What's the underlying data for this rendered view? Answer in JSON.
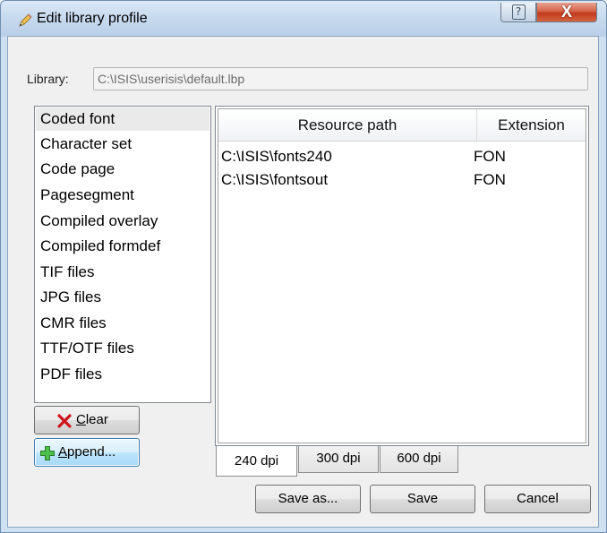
{
  "window": {
    "title": "Edit library profile",
    "close_symbol": "X",
    "help_symbol": "?"
  },
  "library": {
    "label": "Library:",
    "value": "C:\\ISIS\\userisis\\default.lbp"
  },
  "categories": [
    {
      "label": "Coded font",
      "selected": true
    },
    {
      "label": "Character set"
    },
    {
      "label": "Code page"
    },
    {
      "label": "Pagesegment"
    },
    {
      "label": "Compiled overlay"
    },
    {
      "label": "Compiled formdef"
    },
    {
      "label": "TIF files"
    },
    {
      "label": "JPG files"
    },
    {
      "label": "CMR files"
    },
    {
      "label": "TTF/OTF files"
    },
    {
      "label": "PDF files"
    }
  ],
  "table": {
    "headers": [
      "Resource path",
      "Extension"
    ],
    "rows": [
      {
        "path": "C:\\ISIS\\fonts240",
        "ext": "FON"
      },
      {
        "path": "C:\\ISIS\\fontsout",
        "ext": "FON"
      }
    ]
  },
  "tabs": [
    {
      "label": "240 dpi",
      "active": true
    },
    {
      "label": "300 dpi"
    },
    {
      "label": "600 dpi"
    }
  ],
  "buttons": {
    "clear_mnemonic": "C",
    "clear_rest": "lear",
    "append_mnemonic": "A",
    "append_rest": "ppend...",
    "save_as": "Save as...",
    "save": "Save",
    "cancel": "Cancel"
  },
  "icons": {
    "title": "pencil-icon",
    "clear": "red-x-icon",
    "append": "green-plus-icon"
  },
  "colors": {
    "accent": "#3c7fb1",
    "close_red": "#c23a1e",
    "clear_red": "#d0141c",
    "append_green": "#3aa43a"
  }
}
